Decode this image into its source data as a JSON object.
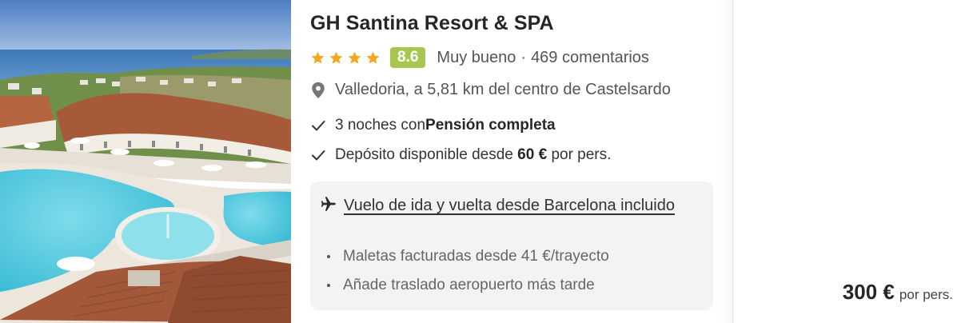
{
  "hotel": {
    "name": "GH Santina Resort & SPA",
    "stars": 4,
    "score": "8.6",
    "score_label": "Muy bueno",
    "separator": "·",
    "reviews": "469 comentarios",
    "location": "Valledoria, a 5,81 km del centro de Castelsardo"
  },
  "features": [
    {
      "prefix": "3 noches con ",
      "bold": "Pensión completa",
      "suffix": ""
    },
    {
      "prefix": "Depósito disponible desde ",
      "bold": "60 €",
      "suffix": " por pers."
    }
  ],
  "flight": {
    "link_text": "Vuelo de ida y vuelta desde Barcelona incluido",
    "bullets": [
      "Maletas facturadas desde 41 €/trayecto",
      "Añade traslado aeropuerto más tarde"
    ]
  },
  "price": {
    "amount": "300 €",
    "unit": "por pers."
  },
  "icons": {
    "star": "star-icon",
    "pin": "map-pin-icon",
    "check": "check-icon",
    "plane": "airplane-icon"
  },
  "colors": {
    "star": "#f5a623",
    "score_bg": "#a7c751",
    "box_bg": "#f3f3f3"
  }
}
